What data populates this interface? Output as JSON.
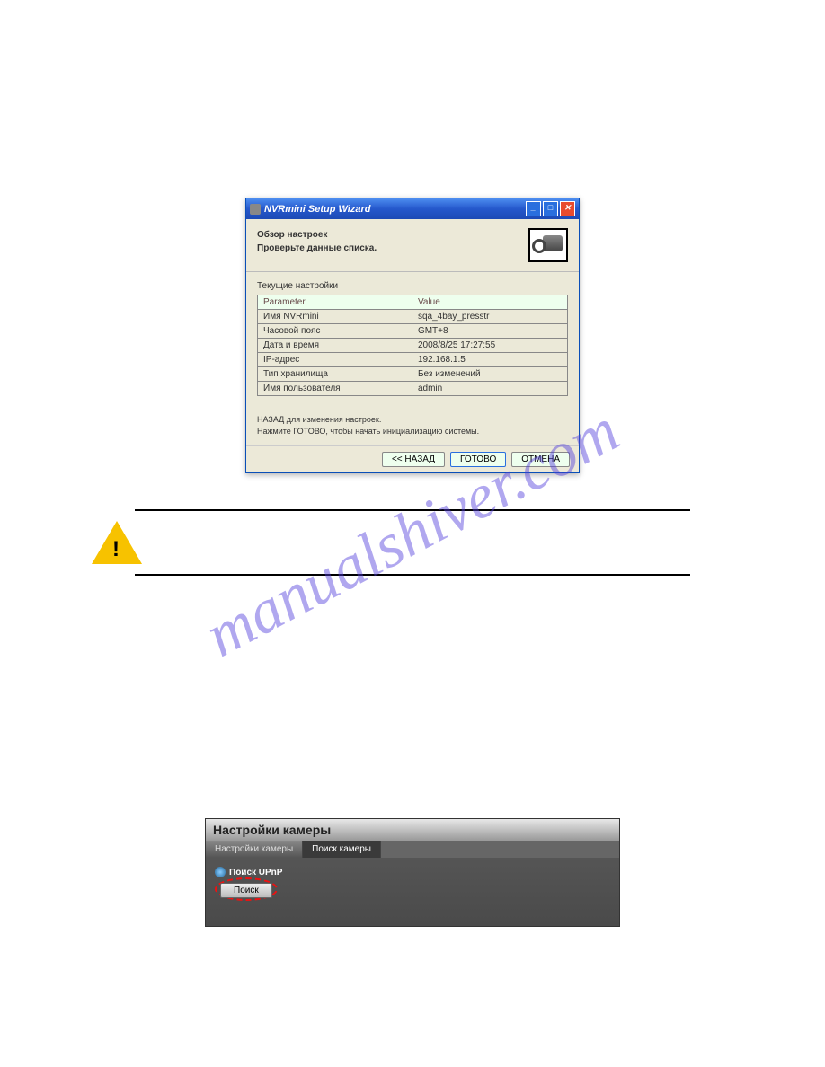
{
  "watermark": "manualshiver.com",
  "window": {
    "title": "NVRmini Setup Wizard",
    "header_title": "Обзор настроек",
    "header_sub": "Проверьте данные списка.",
    "section_label": "Текущие настройки",
    "table": {
      "col_param": "Parameter",
      "col_value": "Value",
      "rows": [
        {
          "p": "Имя NVRmini",
          "v": "sqa_4bay_presstr"
        },
        {
          "p": "Часовой пояс",
          "v": "GMT+8"
        },
        {
          "p": "Дата и время",
          "v": "2008/8/25 17:27:55"
        },
        {
          "p": "IP-адрес",
          "v": "192.168.1.5"
        },
        {
          "p": "Тип хранилища",
          "v": "Без изменений"
        },
        {
          "p": "Имя пользователя",
          "v": "admin"
        }
      ]
    },
    "hint1": "НАЗАД для изменения настроек.",
    "hint2": "Нажмите ГОТОВО, чтобы начать инициализацию системы.",
    "buttons": {
      "back": "<< НАЗАД",
      "finish": "ГОТОВО",
      "cancel": "ОТМЕНА"
    }
  },
  "camera_panel": {
    "title": "Настройки камеры",
    "tab1": "Настройки камеры",
    "tab2": "Поиск камеры",
    "upnp_label": "Поиск UPnP",
    "search_btn": "Поиск"
  }
}
